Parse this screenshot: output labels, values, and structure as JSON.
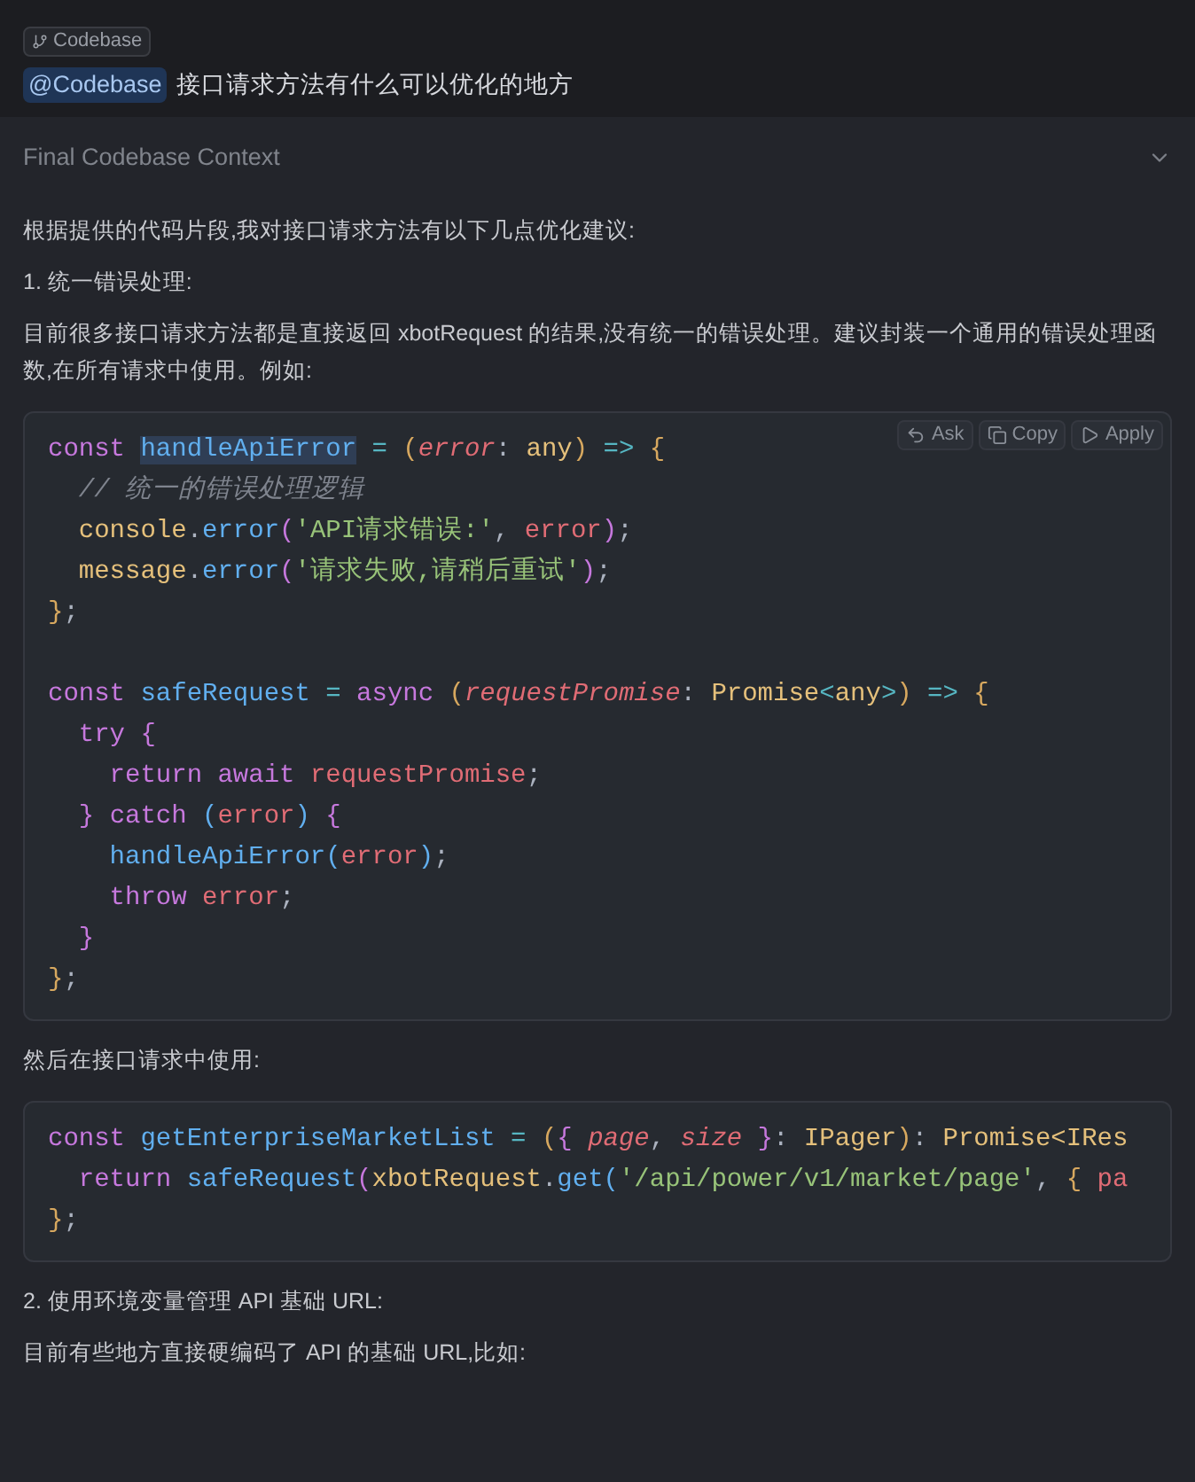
{
  "context_tag": {
    "label": "Codebase"
  },
  "query": {
    "mention": "@Codebase",
    "text": "接口请求方法有什么可以优化的地方"
  },
  "context_section": {
    "title": "Final Codebase Context",
    "expanded": false
  },
  "answer": [
    {
      "kind": "text",
      "text": "根据提供的代码片段,我对接口请求方法有以下几点优化建议:"
    },
    {
      "kind": "text",
      "text": "1. 统一错误处理:"
    },
    {
      "kind": "text",
      "text": "目前很多接口请求方法都是直接返回 xbotRequest 的结果,没有统一的错误处理。建议封装一个通用的错误处理函数,在所有请求中使用。例如:"
    },
    {
      "kind": "code",
      "actions": [
        {
          "kind": "ask",
          "label": "Ask"
        },
        {
          "kind": "copy",
          "label": "Copy"
        },
        {
          "kind": "apply",
          "label": "Apply"
        }
      ],
      "lines": [
        {
          "kind": "code",
          "tokens": [
            {
              "kind": "kw",
              "text": "const "
            },
            {
              "kind": "sel",
              "text": "handleApiError"
            },
            {
              "kind": "op",
              "text": " = "
            },
            {
              "kind": "p1",
              "text": "("
            },
            {
              "kind": "param",
              "text": "error"
            },
            {
              "kind": "punc",
              "text": ": "
            },
            {
              "kind": "type",
              "text": "any"
            },
            {
              "kind": "p1",
              "text": ")"
            },
            {
              "kind": "op",
              "text": " => "
            },
            {
              "kind": "p1",
              "text": "{"
            }
          ]
        },
        {
          "kind": "code",
          "tokens": [
            {
              "kind": "cmt",
              "text": "  // 统一的错误处理逻辑"
            }
          ]
        },
        {
          "kind": "code",
          "tokens": [
            {
              "kind": "type",
              "text": "  console"
            },
            {
              "kind": "punc",
              "text": "."
            },
            {
              "kind": "fn",
              "text": "error"
            },
            {
              "kind": "p2",
              "text": "("
            },
            {
              "kind": "str",
              "text": "'API请求错误:'"
            },
            {
              "kind": "punc",
              "text": ", "
            },
            {
              "kind": "var",
              "text": "error"
            },
            {
              "kind": "p2",
              "text": ")"
            },
            {
              "kind": "punc",
              "text": ";"
            }
          ]
        },
        {
          "kind": "code",
          "tokens": [
            {
              "kind": "type",
              "text": "  message"
            },
            {
              "kind": "punc",
              "text": "."
            },
            {
              "kind": "fn",
              "text": "error"
            },
            {
              "kind": "p2",
              "text": "("
            },
            {
              "kind": "str",
              "text": "'请求失败,请稍后重试'"
            },
            {
              "kind": "p2",
              "text": ")"
            },
            {
              "kind": "punc",
              "text": ";"
            }
          ]
        },
        {
          "kind": "code",
          "tokens": [
            {
              "kind": "p1",
              "text": "}"
            },
            {
              "kind": "punc",
              "text": ";"
            }
          ]
        },
        {
          "kind": "blank"
        },
        {
          "kind": "code",
          "tokens": [
            {
              "kind": "kw",
              "text": "const "
            },
            {
              "kind": "fn",
              "text": "safeRequest"
            },
            {
              "kind": "op",
              "text": " = "
            },
            {
              "kind": "kw",
              "text": "async "
            },
            {
              "kind": "p1",
              "text": "("
            },
            {
              "kind": "param",
              "text": "requestPromise"
            },
            {
              "kind": "punc",
              "text": ": "
            },
            {
              "kind": "type",
              "text": "Promise"
            },
            {
              "kind": "op",
              "text": "<"
            },
            {
              "kind": "type",
              "text": "any"
            },
            {
              "kind": "op",
              "text": ">"
            },
            {
              "kind": "p1",
              "text": ")"
            },
            {
              "kind": "op",
              "text": " => "
            },
            {
              "kind": "p1",
              "text": "{"
            }
          ]
        },
        {
          "kind": "code",
          "tokens": [
            {
              "kind": "kw",
              "text": "  try "
            },
            {
              "kind": "p2",
              "text": "{"
            }
          ]
        },
        {
          "kind": "code",
          "tokens": [
            {
              "kind": "kw",
              "text": "    return await "
            },
            {
              "kind": "var",
              "text": "requestPromise"
            },
            {
              "kind": "punc",
              "text": ";"
            }
          ]
        },
        {
          "kind": "code",
          "tokens": [
            {
              "kind": "p2",
              "text": "  } "
            },
            {
              "kind": "kw",
              "text": "catch "
            },
            {
              "kind": "p3",
              "text": "("
            },
            {
              "kind": "var",
              "text": "error"
            },
            {
              "kind": "p3",
              "text": ") "
            },
            {
              "kind": "p2",
              "text": "{"
            }
          ]
        },
        {
          "kind": "code",
          "tokens": [
            {
              "kind": "fn",
              "text": "    handleApiError"
            },
            {
              "kind": "p3",
              "text": "("
            },
            {
              "kind": "var",
              "text": "error"
            },
            {
              "kind": "p3",
              "text": ")"
            },
            {
              "kind": "punc",
              "text": ";"
            }
          ]
        },
        {
          "kind": "code",
          "tokens": [
            {
              "kind": "kw",
              "text": "    throw "
            },
            {
              "kind": "var",
              "text": "error"
            },
            {
              "kind": "punc",
              "text": ";"
            }
          ]
        },
        {
          "kind": "code",
          "tokens": [
            {
              "kind": "p2",
              "text": "  }"
            }
          ]
        },
        {
          "kind": "code",
          "tokens": [
            {
              "kind": "p1",
              "text": "}"
            },
            {
              "kind": "punc",
              "text": ";"
            }
          ]
        }
      ]
    },
    {
      "kind": "text",
      "text": "然后在接口请求中使用:"
    },
    {
      "kind": "code",
      "lines": [
        {
          "kind": "code",
          "tokens": [
            {
              "kind": "kw",
              "text": "const "
            },
            {
              "kind": "fn",
              "text": "getEnterpriseMarketList"
            },
            {
              "kind": "op",
              "text": " = "
            },
            {
              "kind": "p1",
              "text": "("
            },
            {
              "kind": "p2",
              "text": "{ "
            },
            {
              "kind": "param",
              "text": "page"
            },
            {
              "kind": "punc",
              "text": ", "
            },
            {
              "kind": "param",
              "text": "size"
            },
            {
              "kind": "p2",
              "text": " }"
            },
            {
              "kind": "punc",
              "text": ": "
            },
            {
              "kind": "type",
              "text": "IPager"
            },
            {
              "kind": "p1",
              "text": ")"
            },
            {
              "kind": "punc",
              "text": ": "
            },
            {
              "kind": "type",
              "text": "Promise<IRes"
            }
          ]
        },
        {
          "kind": "code",
          "tokens": [
            {
              "kind": "kw",
              "text": "  return "
            },
            {
              "kind": "fn",
              "text": "safeRequest"
            },
            {
              "kind": "p2",
              "text": "("
            },
            {
              "kind": "type",
              "text": "xbotRequest"
            },
            {
              "kind": "punc",
              "text": "."
            },
            {
              "kind": "fn",
              "text": "get"
            },
            {
              "kind": "p3",
              "text": "("
            },
            {
              "kind": "str",
              "text": "'/api/power/v1/market/page'"
            },
            {
              "kind": "punc",
              "text": ", "
            },
            {
              "kind": "p1",
              "text": "{ "
            },
            {
              "kind": "var",
              "text": "pa"
            }
          ]
        },
        {
          "kind": "code",
          "tokens": [
            {
              "kind": "p1",
              "text": "}"
            },
            {
              "kind": "punc",
              "text": ";"
            }
          ]
        }
      ]
    },
    {
      "kind": "text",
      "text": "2. 使用环境变量管理 API 基础 URL:"
    },
    {
      "kind": "text",
      "text": "目前有些地方直接硬编码了 API 的基础 URL,比如:"
    }
  ]
}
